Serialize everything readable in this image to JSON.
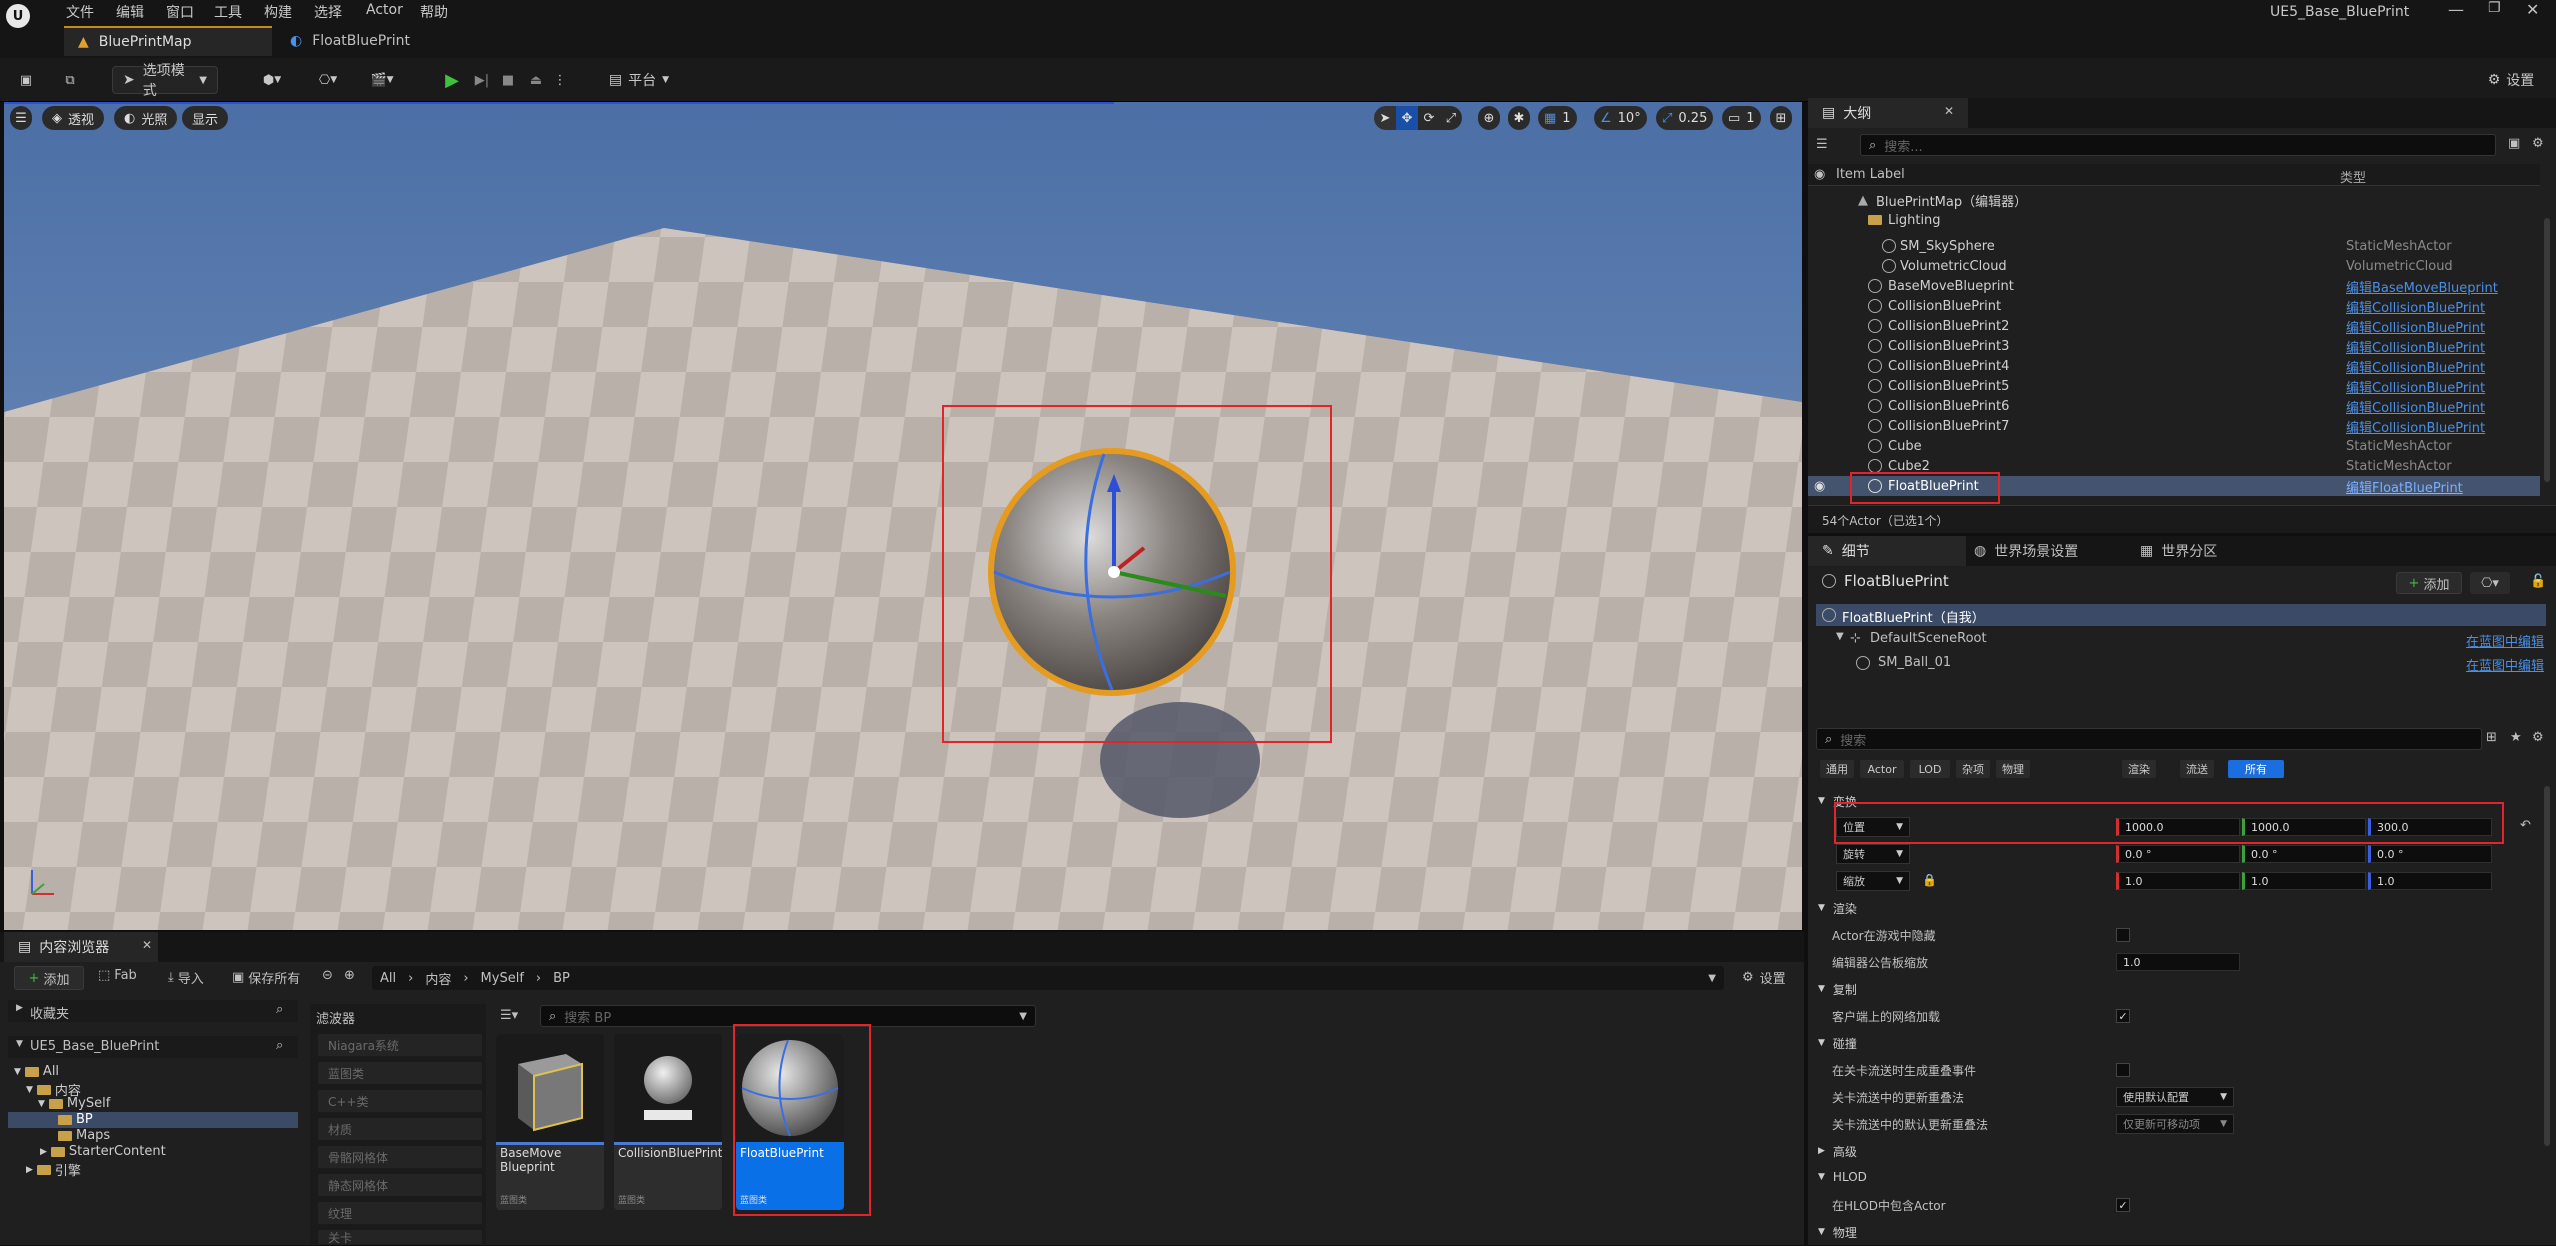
{
  "window": {
    "title": "UE5_Base_BluePrint",
    "min_icon": "minimize-icon",
    "max_icon": "maximize-icon",
    "close_icon": "close-icon"
  },
  "menu": [
    "文件",
    "编辑",
    "窗口",
    "工具",
    "构建",
    "选择",
    "Actor",
    "帮助"
  ],
  "doc_tabs": [
    {
      "label": "BluePrintMap"
    },
    {
      "label": "FloatBluePrint"
    }
  ],
  "toolbar": {
    "mode_label": "选项模式",
    "platform_label": "平台",
    "settings_label": "设置"
  },
  "viewport": {
    "perspective_label": "透视",
    "lit_label": "光照",
    "show_label": "显示",
    "grid_value": "1",
    "angle_value": "10°",
    "scale_value": "0.25",
    "camera_speed": "1"
  },
  "outliner": {
    "tab_label": "大纲",
    "search_placeholder": "搜索...",
    "col_label": "Item Label",
    "col_type": "类型",
    "footer": "54个Actor（已选1个）",
    "rows": [
      {
        "label": "BluePrintMap（编辑器）",
        "type": ""
      },
      {
        "label": "Lighting",
        "type": ""
      },
      {
        "label": "SM_SkySphere",
        "type": "StaticMeshActor"
      },
      {
        "label": "VolumetricCloud",
        "type": "VolumetricCloud"
      },
      {
        "label": "BaseMoveBlueprint",
        "type": "编辑BaseMoveBlueprint"
      },
      {
        "label": "CollisionBluePrint",
        "type": "编辑CollisionBluePrint"
      },
      {
        "label": "CollisionBluePrint2",
        "type": "编辑CollisionBluePrint"
      },
      {
        "label": "CollisionBluePrint3",
        "type": "编辑CollisionBluePrint"
      },
      {
        "label": "CollisionBluePrint4",
        "type": "编辑CollisionBluePrint"
      },
      {
        "label": "CollisionBluePrint5",
        "type": "编辑CollisionBluePrint"
      },
      {
        "label": "CollisionBluePrint6",
        "type": "编辑CollisionBluePrint"
      },
      {
        "label": "CollisionBluePrint7",
        "type": "编辑CollisionBluePrint"
      },
      {
        "label": "Cube",
        "type": "StaticMeshActor"
      },
      {
        "label": "Cube2",
        "type": "StaticMeshActor"
      },
      {
        "label": "FloatBluePrint",
        "type": "编辑FloatBluePrint"
      }
    ]
  },
  "details": {
    "tabs": [
      "细节",
      "世界场景设置",
      "世界分区"
    ],
    "actor_name": "FloatBluePrint",
    "add_label": "添加",
    "components": [
      {
        "label": "FloatBluePrint（自我）",
        "link": ""
      },
      {
        "label": "DefaultSceneRoot",
        "link": "在蓝图中编辑"
      },
      {
        "label": "SM_Ball_01",
        "link": "在蓝图中编辑"
      }
    ],
    "search_placeholder": "搜索",
    "filter_tabs": [
      "通用",
      "Actor",
      "LOD",
      "杂项",
      "物理",
      "渲染",
      "流送",
      "所有"
    ],
    "transform_header": "变换",
    "location_label": "位置",
    "location": [
      "1000.0",
      "1000.0",
      "300.0"
    ],
    "rotation_label": "旋转",
    "rotation": [
      "0.0 °",
      "0.0 °",
      "0.0 °"
    ],
    "scale_label": "缩放",
    "scale": [
      "1.0",
      "1.0",
      "1.0"
    ],
    "render_header": "渲染",
    "hidden_label": "Actor在游戏中隐藏",
    "billboard_label": "编辑器公告板缩放",
    "billboard_value": "1.0",
    "replication_header": "复制",
    "net_load_label": "客户端上的网络加载",
    "collision_header": "碰撞",
    "overlap_label": "在关卡流送时生成重叠事件",
    "update_overlap_label": "关卡流送中的更新重叠法",
    "update_overlap_value": "使用默认配置",
    "default_overlap_label": "关卡流送中的默认更新重叠法",
    "default_overlap_value": "仅更新可移动项",
    "advanced_header": "高级",
    "hlod_header": "HLOD",
    "hlod_include_label": "在HLOD中包含Actor",
    "physics_header": "物理"
  },
  "content_browser": {
    "tab_label": "内容浏览器",
    "add_label": "添加",
    "fab_label": "Fab",
    "import_label": "导入",
    "save_all_label": "保存所有",
    "path": [
      "All",
      "内容",
      "MySelf",
      "BP"
    ],
    "settings_label": "设置",
    "favorites_label": "收藏夹",
    "project_label": "UE5_Base_BluePrint",
    "tree": [
      "All",
      "内容",
      "MySelf",
      "BP",
      "Maps",
      "StarterContent",
      "引擎"
    ],
    "filters_label": "滤波器",
    "filters": [
      "Niagara系统",
      "蓝图类",
      "C++类",
      "材质",
      "骨骼网格体",
      "静态网格体",
      "纹理",
      "关卡"
    ],
    "search_placeholder": "搜索 BP",
    "assets": [
      {
        "name": "BaseMove Blueprint",
        "type": "蓝图类"
      },
      {
        "name": "CollisionBluePrint",
        "type": "蓝图类"
      },
      {
        "name": "FloatBluePrint",
        "type": "蓝图类"
      }
    ]
  },
  "colors": {
    "accent": "#2d5fc9",
    "selection": "#0a70e8",
    "highlight": "#e3252b",
    "link": "#4a8fe8"
  }
}
